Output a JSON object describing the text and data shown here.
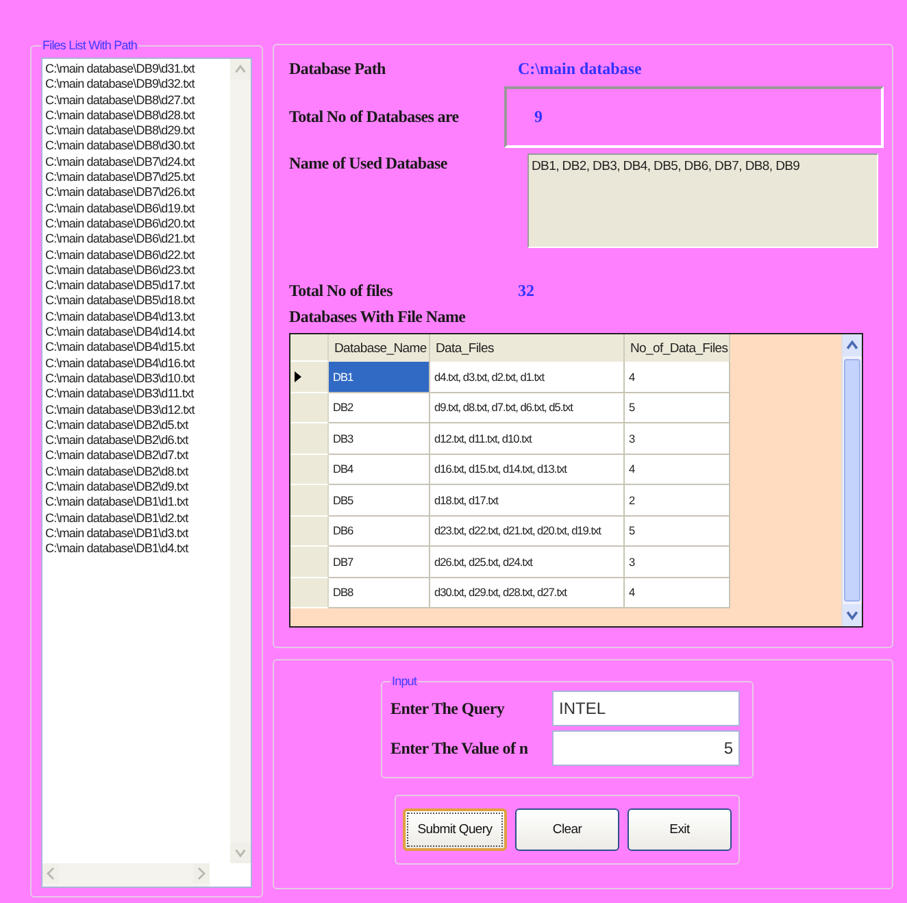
{
  "files_group": {
    "title": "Files List With Path",
    "files": [
      "C:\\main database\\DB9\\d31.txt",
      "C:\\main database\\DB9\\d32.txt",
      "C:\\main database\\DB8\\d27.txt",
      "C:\\main database\\DB8\\d28.txt",
      "C:\\main database\\DB8\\d29.txt",
      "C:\\main database\\DB8\\d30.txt",
      "C:\\main database\\DB7\\d24.txt",
      "C:\\main database\\DB7\\d25.txt",
      "C:\\main database\\DB7\\d26.txt",
      "C:\\main database\\DB6\\d19.txt",
      "C:\\main database\\DB6\\d20.txt",
      "C:\\main database\\DB6\\d21.txt",
      "C:\\main database\\DB6\\d22.txt",
      "C:\\main database\\DB6\\d23.txt",
      "C:\\main database\\DB5\\d17.txt",
      "C:\\main database\\DB5\\d18.txt",
      "C:\\main database\\DB4\\d13.txt",
      "C:\\main database\\DB4\\d14.txt",
      "C:\\main database\\DB4\\d15.txt",
      "C:\\main database\\DB4\\d16.txt",
      "C:\\main database\\DB3\\d10.txt",
      "C:\\main database\\DB3\\d11.txt",
      "C:\\main database\\DB3\\d12.txt",
      "C:\\main database\\DB2\\d5.txt",
      "C:\\main database\\DB2\\d6.txt",
      "C:\\main database\\DB2\\d7.txt",
      "C:\\main database\\DB2\\d8.txt",
      "C:\\main database\\DB2\\d9.txt",
      "C:\\main database\\DB1\\d1.txt",
      "C:\\main database\\DB1\\d2.txt",
      "C:\\main database\\DB1\\d3.txt",
      "C:\\main database\\DB1\\d4.txt"
    ]
  },
  "info": {
    "path_label": "Database Path",
    "path_value": "C:\\main database",
    "count_label": "Total No of Databases are",
    "count_value": "9",
    "names_label": "Name of Used Database",
    "names_value": "DB1, DB2, DB3, DB4, DB5, DB6, DB7, DB8, DB9",
    "files_label": "Total No of  files",
    "files_value": "32",
    "table_label": "Databases With File Name"
  },
  "table": {
    "columns": [
      "Database_Name",
      "Data_Files",
      "No_of_Data_Files"
    ],
    "rows": [
      {
        "cells": [
          "DB1",
          "d4.txt, d3.txt, d2.txt, d1.txt",
          "4"
        ],
        "selected": true
      },
      {
        "cells": [
          "DB2",
          "d9.txt, d8.txt, d7.txt, d6.txt, d5.txt",
          "5"
        ],
        "selected": false
      },
      {
        "cells": [
          "DB3",
          "d12.txt, d11.txt, d10.txt",
          "3"
        ],
        "selected": false
      },
      {
        "cells": [
          "DB4",
          "d16.txt, d15.txt, d14.txt, d13.txt",
          "4"
        ],
        "selected": false
      },
      {
        "cells": [
          "DB5",
          "d18.txt, d17.txt",
          "2"
        ],
        "selected": false
      },
      {
        "cells": [
          "DB6",
          "d23.txt, d22.txt, d21.txt, d20.txt, d19.txt",
          "5"
        ],
        "selected": false
      },
      {
        "cells": [
          "DB7",
          "d26.txt, d25.txt, d24.txt",
          "3"
        ],
        "selected": false
      },
      {
        "cells": [
          "DB8",
          "d30.txt, d29.txt, d28.txt, d27.txt",
          "4"
        ],
        "selected": false
      }
    ]
  },
  "input_group": {
    "title": "Input",
    "query_label": "Enter The Query",
    "query_value": "INTEL",
    "n_label": "Enter The Value of n",
    "n_value": "5"
  },
  "buttons": [
    {
      "label": "Submit Query",
      "focused": true
    },
    {
      "label": "Clear",
      "focused": false
    },
    {
      "label": "Exit",
      "focused": false
    }
  ]
}
